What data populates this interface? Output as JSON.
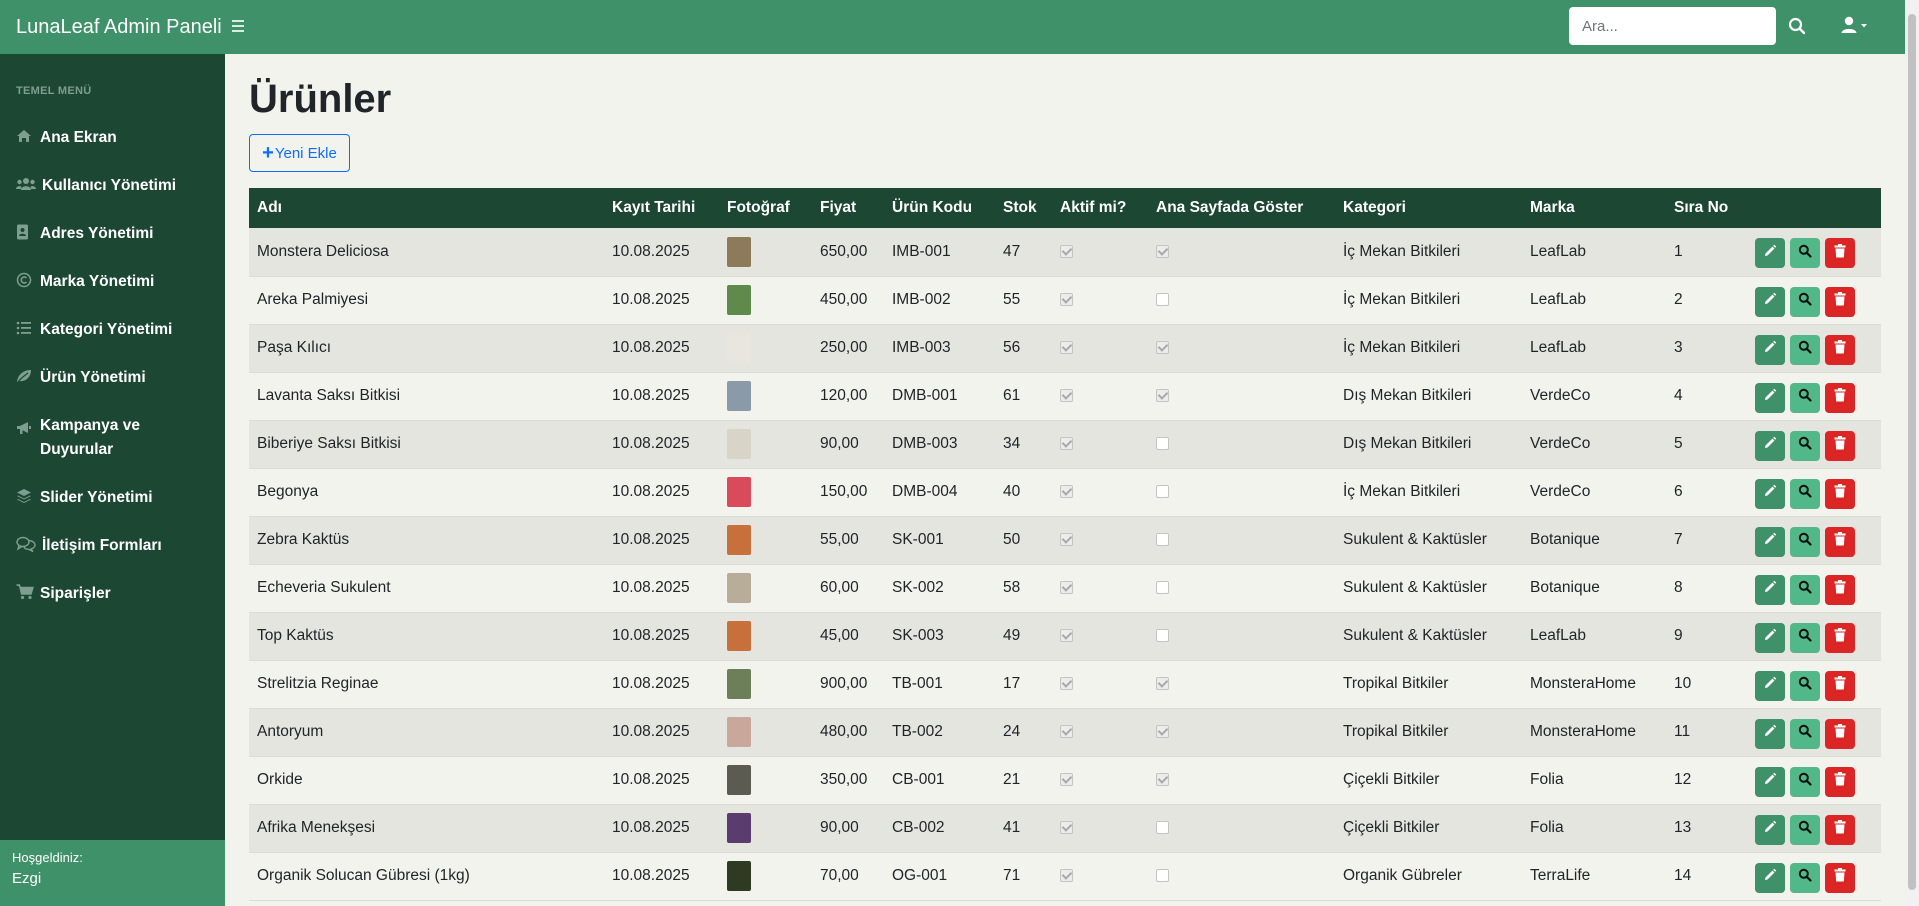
{
  "app": {
    "brand": "LunaLeaf Admin Paneli"
  },
  "search": {
    "placeholder": "Ara..."
  },
  "sidebar": {
    "heading": "TEMEL MENÜ",
    "items": [
      {
        "label": "Ana Ekran",
        "icon": "home-icon"
      },
      {
        "label": "Kullanıcı Yönetimi",
        "icon": "users-icon"
      },
      {
        "label": "Adres Yönetimi",
        "icon": "address-book-icon"
      },
      {
        "label": "Marka Yönetimi",
        "icon": "copyright-icon"
      },
      {
        "label": "Kategori Yönetimi",
        "icon": "list-icon"
      },
      {
        "label": "Ürün Yönetimi",
        "icon": "leaf-icon"
      },
      {
        "label": "Kampanya ve Duyurular",
        "icon": "bullhorn-icon"
      },
      {
        "label": "Slider Yönetimi",
        "icon": "layers-icon"
      },
      {
        "label": "İletişim Formları",
        "icon": "comments-icon"
      },
      {
        "label": "Siparişler",
        "icon": "cart-icon"
      }
    ],
    "footer": {
      "welcome": "Hoşgeldiniz:",
      "username": "Ezgi"
    }
  },
  "page": {
    "title": "Ürünler",
    "add_button": "Yeni Ekle"
  },
  "table": {
    "headers": [
      "Adı",
      "Kayıt Tarihi",
      "Fotoğraf",
      "Fiyat",
      "Ürün Kodu",
      "Stok",
      "Aktif mi?",
      "Ana Sayfada Göster",
      "Kategori",
      "Marka",
      "Sıra No",
      ""
    ],
    "rows": [
      {
        "name": "Monstera Deliciosa",
        "date": "10.08.2025",
        "price": "650,00",
        "code": "IMB-001",
        "stock": "47",
        "active": true,
        "homepage": true,
        "category": "İç Mekan Bitkileri",
        "brand": "LeafLab",
        "order": "1",
        "photo_color": "#8d7a5a"
      },
      {
        "name": "Areka Palmiyesi",
        "date": "10.08.2025",
        "price": "450,00",
        "code": "IMB-002",
        "stock": "55",
        "active": true,
        "homepage": false,
        "category": "İç Mekan Bitkileri",
        "brand": "LeafLab",
        "order": "2",
        "photo_color": "#5f8a4c"
      },
      {
        "name": "Paşa Kılıcı",
        "date": "10.08.2025",
        "price": "250,00",
        "code": "IMB-003",
        "stock": "56",
        "active": true,
        "homepage": true,
        "category": "İç Mekan Bitkileri",
        "brand": "LeafLab",
        "order": "3",
        "photo_color": "#e9e6df"
      },
      {
        "name": "Lavanta Saksı Bitkisi",
        "date": "10.08.2025",
        "price": "120,00",
        "code": "DMB-001",
        "stock": "61",
        "active": true,
        "homepage": true,
        "category": "Dış Mekan Bitkileri",
        "brand": "VerdeCo",
        "order": "4",
        "photo_color": "#8a9aa8"
      },
      {
        "name": "Biberiye Saksı Bitkisi",
        "date": "10.08.2025",
        "price": "90,00",
        "code": "DMB-003",
        "stock": "34",
        "active": true,
        "homepage": false,
        "category": "Dış Mekan Bitkileri",
        "brand": "VerdeCo",
        "order": "5",
        "photo_color": "#d9d4c8"
      },
      {
        "name": "Begonya",
        "date": "10.08.2025",
        "price": "150,00",
        "code": "DMB-004",
        "stock": "40",
        "active": true,
        "homepage": false,
        "category": "İç Mekan Bitkileri",
        "brand": "VerdeCo",
        "order": "6",
        "photo_color": "#d94a5a"
      },
      {
        "name": "Zebra Kaktüs",
        "date": "10.08.2025",
        "price": "55,00",
        "code": "SK-001",
        "stock": "50",
        "active": true,
        "homepage": false,
        "category": "Sukulent & Kaktüsler",
        "brand": "Botanique",
        "order": "7",
        "photo_color": "#c8703c"
      },
      {
        "name": "Echeveria Sukulent",
        "date": "10.08.2025",
        "price": "60,00",
        "code": "SK-002",
        "stock": "58",
        "active": true,
        "homepage": false,
        "category": "Sukulent & Kaktüsler",
        "brand": "Botanique",
        "order": "8",
        "photo_color": "#b8ad98"
      },
      {
        "name": "Top Kaktüs",
        "date": "10.08.2025",
        "price": "45,00",
        "code": "SK-003",
        "stock": "49",
        "active": true,
        "homepage": false,
        "category": "Sukulent & Kaktüsler",
        "brand": "LeafLab",
        "order": "9",
        "photo_color": "#c8703c"
      },
      {
        "name": "Strelitzia Reginae",
        "date": "10.08.2025",
        "price": "900,00",
        "code": "TB-001",
        "stock": "17",
        "active": true,
        "homepage": true,
        "category": "Tropikal Bitkiler",
        "brand": "MonsteraHome",
        "order": "10",
        "photo_color": "#6d7f58"
      },
      {
        "name": "Antoryum",
        "date": "10.08.2025",
        "price": "480,00",
        "code": "TB-002",
        "stock": "24",
        "active": true,
        "homepage": true,
        "category": "Tropikal Bitkiler",
        "brand": "MonsteraHome",
        "order": "11",
        "photo_color": "#c9a79a"
      },
      {
        "name": "Orkide",
        "date": "10.08.2025",
        "price": "350,00",
        "code": "CB-001",
        "stock": "21",
        "active": true,
        "homepage": true,
        "category": "Çiçekli Bitkiler",
        "brand": "Folia",
        "order": "12",
        "photo_color": "#5b5b52"
      },
      {
        "name": "Afrika Menekşesi",
        "date": "10.08.2025",
        "price": "90,00",
        "code": "CB-002",
        "stock": "41",
        "active": true,
        "homepage": false,
        "category": "Çiçekli Bitkiler",
        "brand": "Folia",
        "order": "13",
        "photo_color": "#5a3d6e"
      },
      {
        "name": "Organik Solucan Gübresi (1kg)",
        "date": "10.08.2025",
        "price": "70,00",
        "code": "OG-001",
        "stock": "71",
        "active": true,
        "homepage": false,
        "category": "Organik Gübreler",
        "brand": "TerraLife",
        "order": "14",
        "photo_color": "#2f3a22"
      }
    ]
  },
  "colors": {
    "navbar": "#3f916a",
    "sidebar": "#1c4733",
    "edit_button": "#3f916a",
    "view_button": "#52b889",
    "delete_button": "#dc2626",
    "primary_outline": "#0d6efd"
  }
}
